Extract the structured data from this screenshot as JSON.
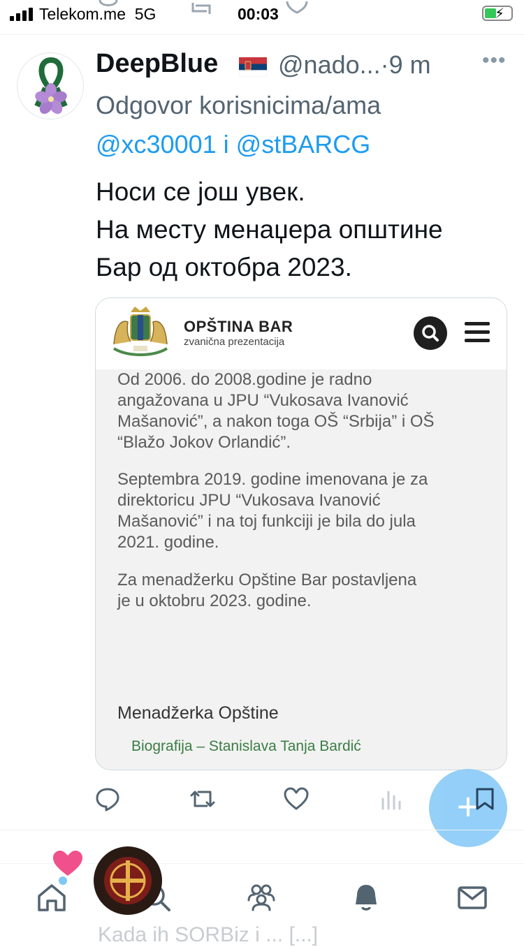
{
  "status_bar": {
    "carrier": "Telekom.me",
    "network": "5G",
    "time": "00:03"
  },
  "tweet": {
    "author_name": "DeepBlue",
    "author_handle": "@nado...",
    "separator": "·",
    "time_ago": "9 m",
    "reply_prefix": "Odgovor korisnicima/ama",
    "reply_mentions": "@xc30001 i @stBARCG",
    "text_lines": [
      "Носи се још увек.",
      "На месту менаџера општине",
      "Бар од октобра 2023."
    ],
    "more_label": "•••"
  },
  "card": {
    "site_title": "OPŠTINA BAR",
    "site_subtitle": "zvanična prezentacija",
    "paragraphs": [
      [
        "Od 2006. do 2008.godine je radno",
        "angažovana u  JPU “Vukosava Ivanović",
        "Mašanović”, a nakon toga OŠ “Srbija” i OŠ",
        "“Blažo Jokov Orlandić”."
      ],
      [
        "Septembra 2019. godine imenovana je za",
        "direktoricu JPU “Vukosava Ivanović",
        "Mašanović” i na toj funkciji je bila do jula",
        "2021. godine."
      ],
      [
        "Za menadžerku Opštine Bar postavljena",
        "je u oktobru 2023. godine."
      ]
    ],
    "role": "Menadžerka Opštine",
    "link_text": "Biografija – Stanislava Tanja Bardić"
  },
  "fab": {
    "label": "+"
  },
  "peek_text": "Kada ih SORBiz i ... [...]",
  "colors": {
    "link_blue": "#1d9bf0",
    "muted": "#536471",
    "fab": "#8ecdf8",
    "card_link_green": "#3a7d44"
  },
  "icons": [
    "reply-icon",
    "retweet-icon",
    "like-icon",
    "views-icon",
    "bookmark-icon",
    "home-icon",
    "search-icon",
    "communities-icon",
    "notifications-icon",
    "messages-icon"
  ]
}
